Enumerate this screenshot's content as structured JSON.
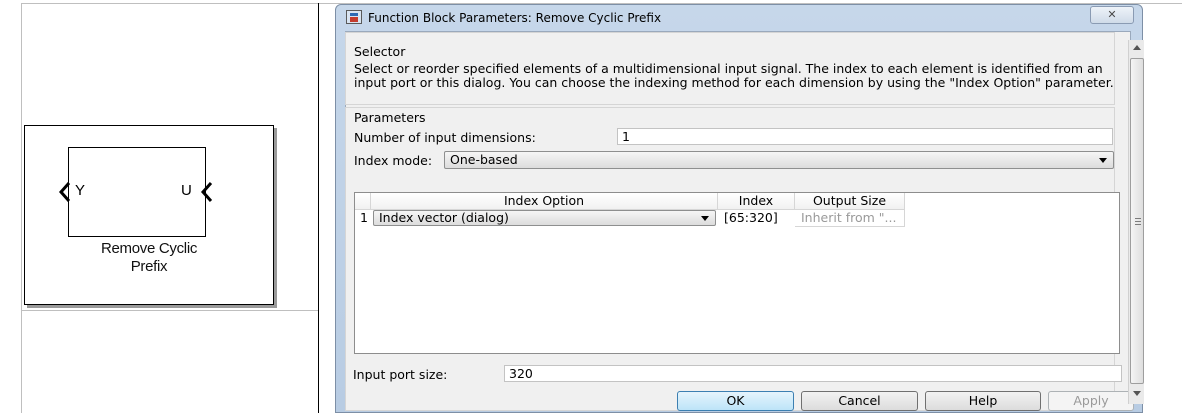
{
  "block": {
    "input_port": "Y",
    "output_port": "U",
    "name_line1": "Remove Cyclic",
    "name_line2": "Prefix"
  },
  "dialog": {
    "title": "Function Block Parameters: Remove Cyclic Prefix",
    "close_label": "✕",
    "selector_title": "Selector",
    "description": "Select or reorder specified elements of a multidimensional input signal. The index to each element is identified from an input port or this dialog. You can choose the indexing method for each dimension by using the \"Index Option\" parameter.",
    "parameters_title": "Parameters",
    "num_dims_label": "Number of input dimensions:",
    "num_dims_value": "1",
    "index_mode_label": "Index mode:",
    "index_mode_value": "One-based",
    "table": {
      "headers": [
        "Index Option",
        "Index",
        "Output Size"
      ],
      "rows": [
        {
          "row_num": "1",
          "index_option": "Index vector (dialog)",
          "index": "[65:320]",
          "output_size": "Inherit from \"..."
        }
      ]
    },
    "port_size_label": "Input port size:",
    "port_size_value": "320",
    "buttons": {
      "ok": "OK",
      "cancel": "Cancel",
      "help": "Help",
      "apply": "Apply"
    }
  }
}
